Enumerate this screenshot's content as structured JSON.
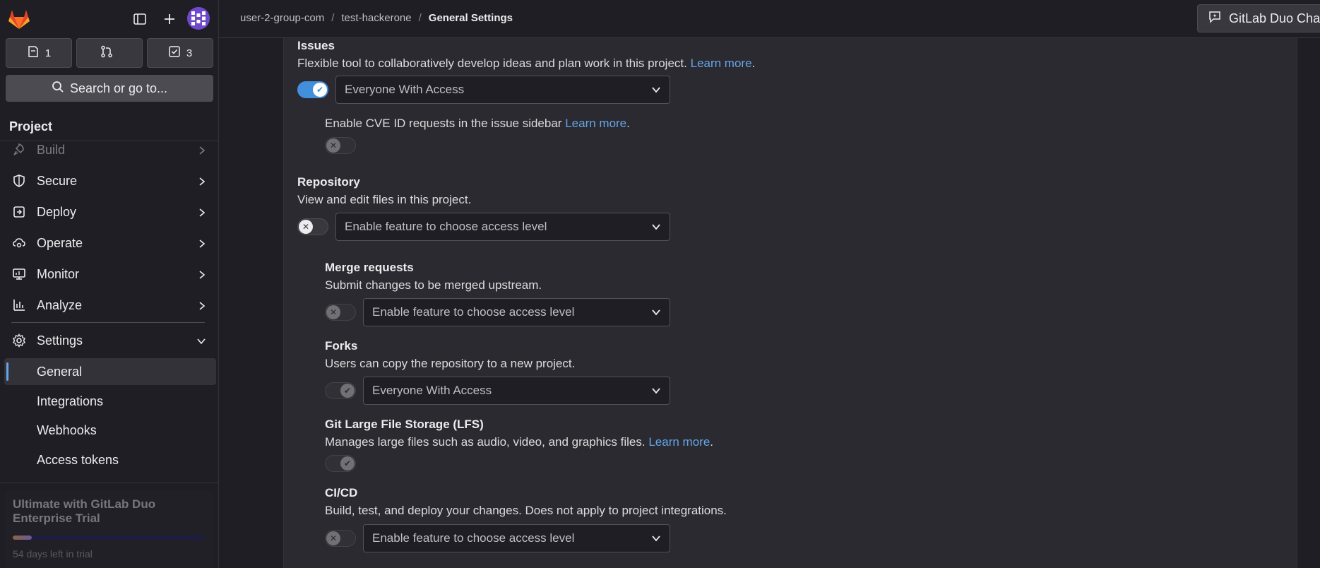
{
  "sidebar": {
    "counts": [
      {
        "icon": "issues-icon",
        "value": "1"
      },
      {
        "icon": "merge-request-icon",
        "value": ""
      },
      {
        "icon": "todo-icon",
        "value": "3"
      }
    ],
    "search_label": "Search or go to...",
    "section_title": "Project",
    "nav": [
      {
        "label": "Build",
        "icon": "rocket-icon"
      },
      {
        "label": "Secure",
        "icon": "shield-icon"
      },
      {
        "label": "Deploy",
        "icon": "deploy-icon"
      },
      {
        "label": "Operate",
        "icon": "cloud-gear-icon"
      },
      {
        "label": "Monitor",
        "icon": "monitor-icon"
      },
      {
        "label": "Analyze",
        "icon": "chart-icon"
      },
      {
        "label": "Settings",
        "icon": "gear-icon"
      }
    ],
    "settings_sub": [
      "General",
      "Integrations",
      "Webhooks",
      "Access tokens"
    ],
    "trial": {
      "title": "Ultimate with GitLab Duo Enterprise Trial",
      "progress_fraction": 0.1,
      "days_left": "54 days left in trial"
    }
  },
  "breadcrumb": [
    "user-2-group-com",
    "test-hackerone",
    "General Settings"
  ],
  "duo_button": "GitLab Duo Chat",
  "features": {
    "issues": {
      "title": "Issues",
      "desc": "Flexible tool to collaboratively develop ideas and plan work in this project.",
      "link": "Learn more",
      "select": "Everyone With Access"
    },
    "cve": {
      "desc": "Enable CVE ID requests in the issue sidebar",
      "link": "Learn more"
    },
    "repository": {
      "title": "Repository",
      "desc": "View and edit files in this project.",
      "select": "Enable feature to choose access level"
    },
    "merge_requests": {
      "title": "Merge requests",
      "desc": "Submit changes to be merged upstream.",
      "select": "Enable feature to choose access level"
    },
    "forks": {
      "title": "Forks",
      "desc": "Users can copy the repository to a new project.",
      "select": "Everyone With Access"
    },
    "lfs": {
      "title": "Git Large File Storage (LFS)",
      "desc": "Manages large files such as audio, video, and graphics files.",
      "link": "Learn more"
    },
    "cicd": {
      "title": "CI/CD",
      "desc": "Build, test, and deploy your changes. Does not apply to project integrations.",
      "select": "Enable feature to choose access level"
    }
  },
  "colors": {
    "accent": "#428fdc",
    "link": "#63a6e9",
    "background": "#1f1e24",
    "panel": "#2b2a30"
  }
}
